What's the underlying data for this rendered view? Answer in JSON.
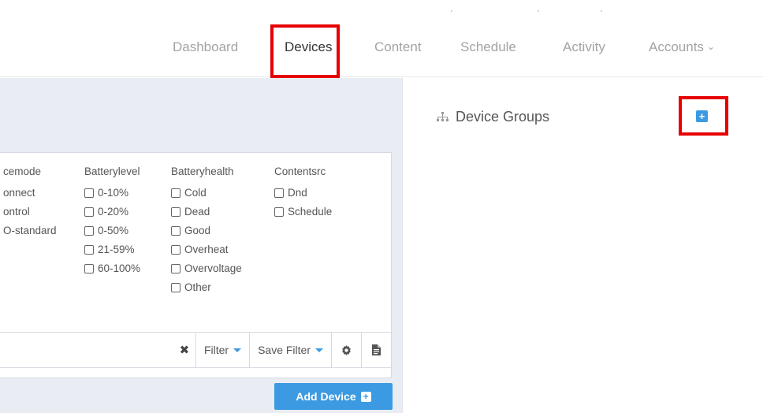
{
  "nav": {
    "items": [
      {
        "label": "Dashboard",
        "active": false
      },
      {
        "label": "Devices",
        "active": true
      },
      {
        "label": "Content",
        "active": false
      },
      {
        "label": "Schedule",
        "active": false
      },
      {
        "label": "Activity",
        "active": false
      },
      {
        "label": "Accounts",
        "active": false
      }
    ]
  },
  "filters": {
    "columns": [
      {
        "header": "cemode",
        "options": [
          "onnect",
          "ontrol",
          "O-standard"
        ]
      },
      {
        "header": "Batterylevel",
        "options": [
          "0-10%",
          "0-20%",
          "0-50%",
          "21-59%",
          "60-100%"
        ]
      },
      {
        "header": "Batteryhealth",
        "options": [
          "Cold",
          "Dead",
          "Good",
          "Overheat",
          "Overvoltage",
          "Other"
        ]
      },
      {
        "header": "Contentsrc",
        "options": [
          "Dnd",
          "Schedule"
        ]
      }
    ]
  },
  "search": {
    "value": "",
    "placeholder": ""
  },
  "toolbar": {
    "filter_label": "Filter",
    "save_filter_label": "Save Filter"
  },
  "add_device_label": "Add Device",
  "device_groups": {
    "title": "Device Groups"
  },
  "colors": {
    "accent": "#3b9ae1",
    "highlight": "#e60000"
  },
  "icons": [
    "chevron-down-icon",
    "close-icon",
    "gear-icon",
    "document-icon",
    "plus-square-icon",
    "sitemap-icon"
  ]
}
